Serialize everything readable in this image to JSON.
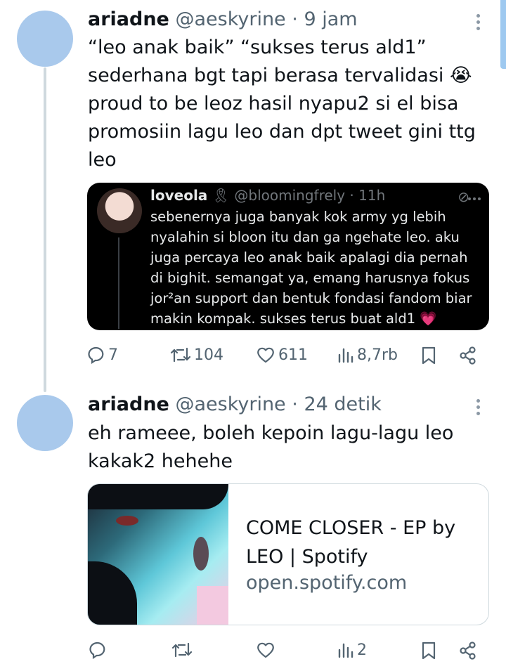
{
  "tweet1": {
    "name": "ariadne",
    "handle": "@aeskyrine",
    "separator": "·",
    "time": "9 jam",
    "lines": [
      "“leo anak baik” “sukses terus ald1”",
      "sederhana bgt tapi berasa tervalidasi 😭",
      "proud to be leoz hasil nyapu2 si el bisa",
      "promosiin lagu leo dan dpt tweet gini ttg",
      "leo"
    ],
    "quote": {
      "name": "loveola",
      "badge": "🎗",
      "handle": "@bloomingfrely",
      "separator": "·",
      "time": "11h",
      "lines": [
        "sebenernya juga banyak kok army yg lebih",
        "nyalahin si bloon itu dan ga ngehate leo. aku",
        "juga percaya leo anak baik apalagi dia pernah",
        "di bighit. semangat ya, emang harusnya fokus",
        "jor²an support dan bentuk fondasi fandom biar",
        "makin kompak. sukses terus buat ald1 💗"
      ]
    },
    "actions": {
      "replies": "7",
      "retweets": "104",
      "likes": "611",
      "views": "8,7rb"
    }
  },
  "tweet2": {
    "name": "ariadne",
    "handle": "@aeskyrine",
    "separator": "·",
    "time": "24 detik",
    "lines": [
      "eh rameee, boleh kepoin lagu-lagu leo",
      "kakak2 hehehe"
    ],
    "card": {
      "title_line1": "COME CLOSER - EP by",
      "title_line2": "LEO | Spotify",
      "domain": "open.spotify.com"
    },
    "actions": {
      "views": "2"
    }
  },
  "icons": [
    "reply-icon",
    "retweet-icon",
    "like-icon",
    "views-icon",
    "bookmark-icon",
    "share-icon",
    "more-icon"
  ],
  "colors": {
    "text": "#0f1419",
    "muted": "#536471",
    "avatar": "#a9c9ec",
    "quote_bg": "#000000"
  }
}
